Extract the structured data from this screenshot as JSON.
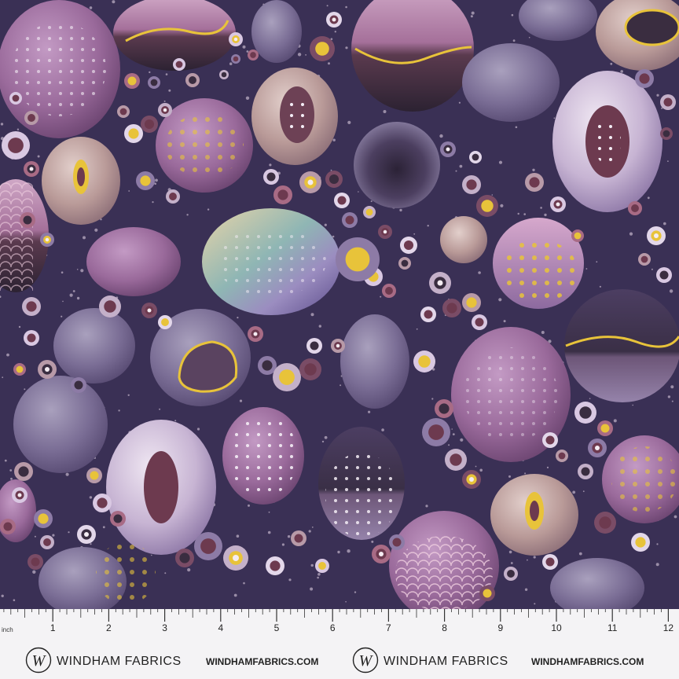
{
  "ruler": {
    "unit_label": "inch",
    "marks": [
      "1",
      "2",
      "3",
      "4",
      "5",
      "6",
      "7",
      "8",
      "9",
      "10",
      "11",
      "12"
    ]
  },
  "brand": {
    "name": "WINDHAM FABRICS",
    "url": "WINDHAMFABRICS.COM",
    "logo_letter": "W"
  },
  "colors": {
    "background": "#3a3055",
    "accent_gold": "#e8c33a",
    "ruler_bg": "#f4f3f5"
  }
}
